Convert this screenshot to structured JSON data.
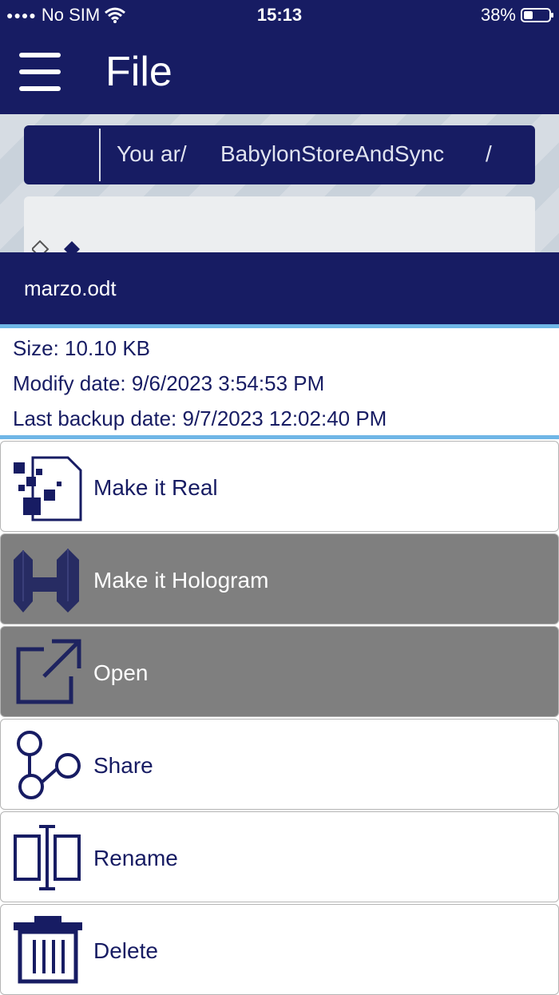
{
  "status_bar": {
    "carrier": "No SIM",
    "time": "15:13",
    "battery": "38%",
    "battery_level": 0.38
  },
  "app_bar": {
    "title": "File"
  },
  "path": {
    "seg1": "You ar/",
    "seg2": "BabylonStoreAndSync",
    "separator": "/"
  },
  "file": {
    "name": "marzo.odt",
    "size": "Size: 10.10 KB",
    "modify_date": "Modify date: 9/6/2023 3:54:53 PM",
    "backup_date": "Last backup date: 9/7/2023 12:02:40 PM"
  },
  "actions": [
    {
      "label": "Make it Real",
      "icon": "make-real-icon",
      "disabled": false
    },
    {
      "label": "Make it Hologram",
      "icon": "hologram-icon",
      "disabled": true
    },
    {
      "label": "Open",
      "icon": "open-external-icon",
      "disabled": true
    },
    {
      "label": "Share",
      "icon": "share-icon",
      "disabled": false
    },
    {
      "label": "Rename",
      "icon": "rename-icon",
      "disabled": false
    },
    {
      "label": "Delete",
      "icon": "trash-icon",
      "disabled": false
    }
  ],
  "colors": {
    "navy": "#171c63",
    "accent": "#6fb6e6",
    "disabled": "#7f7f7f"
  }
}
